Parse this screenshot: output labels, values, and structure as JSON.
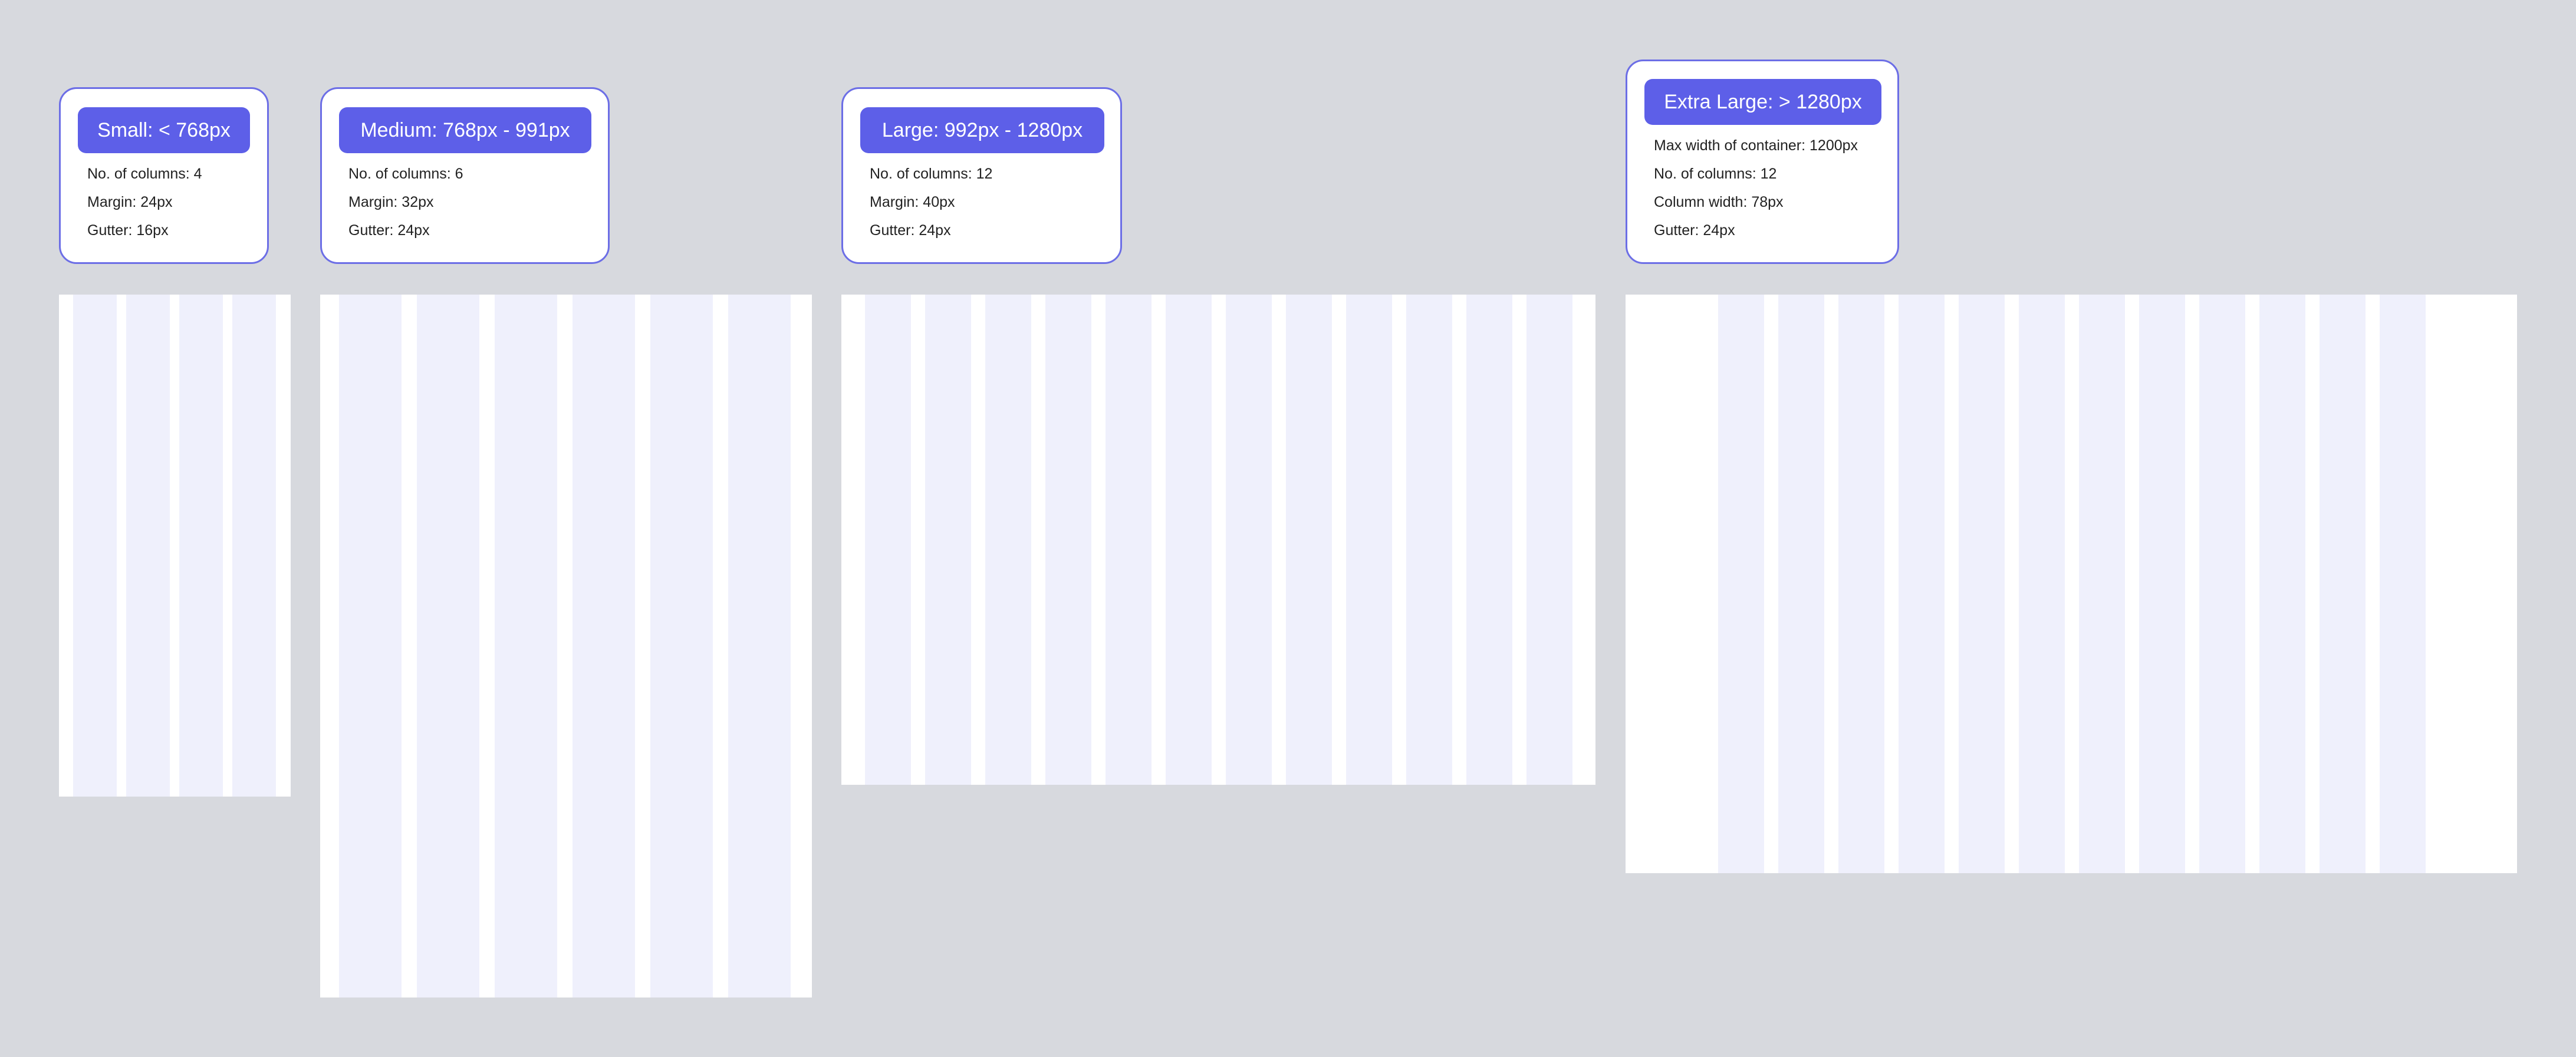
{
  "breakpoints": [
    {
      "title": "Small: < 768px",
      "specs": [
        "No. of columns: 4",
        "Margin: 24px",
        "Gutter: 16px"
      ]
    },
    {
      "title": "Medium: 768px - 991px",
      "specs": [
        "No. of columns: 6",
        "Margin: 32px",
        "Gutter: 24px"
      ]
    },
    {
      "title": "Large: 992px - 1280px",
      "specs": [
        "No. of columns: 12",
        "Margin: 40px",
        "Gutter: 24px"
      ]
    },
    {
      "title": "Extra Large: > 1280px",
      "specs": [
        "Max width of container: 1200px",
        "No. of columns: 12",
        "Column width: 78px",
        "Gutter: 24px"
      ]
    }
  ],
  "colors": {
    "background": "#d7d9de",
    "accent": "#5d5fe8",
    "card_border": "#6c6ee6",
    "column": "#eff0fc",
    "grid_frame": "#ffffff"
  }
}
